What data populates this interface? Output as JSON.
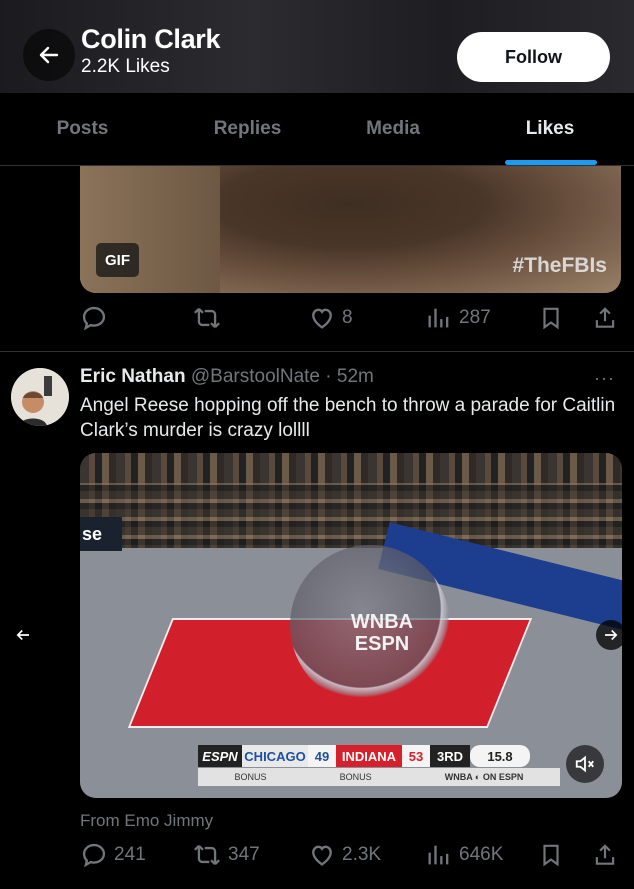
{
  "header": {
    "title": "Colin Clark",
    "subtitle": "2.2K Likes",
    "follow_label": "Follow"
  },
  "tabs": [
    {
      "label": "Posts",
      "active": false
    },
    {
      "label": "Replies",
      "active": false
    },
    {
      "label": "Media",
      "active": false
    },
    {
      "label": "Likes",
      "active": true
    }
  ],
  "tweet1": {
    "media_badge": "GIF",
    "media_caption": "#TheFBIs",
    "likes": "8",
    "views": "287"
  },
  "tweet2": {
    "name": "Eric Nathan",
    "handle": "@BarstoolNate",
    "separator": " · ",
    "time": "52m",
    "more": "···",
    "text": "Angel Reese hopping off the bench to throw a parade for Caitlin Clark’s murder is crazy lollll",
    "video": {
      "overlay_left": "se",
      "logo_line1": "WNBA",
      "logo_line2": "ESPN",
      "score": {
        "network": "ESPN",
        "team1": "CHICAGO",
        "score1": "49",
        "team2": "INDIANA",
        "score2": "53",
        "period": "3RD",
        "clock": "15.8",
        "bonus": "BONUS",
        "league_on": "WNBA ◐ ON ESPN"
      }
    },
    "from": "From Emo Jimmy",
    "replies": "241",
    "reposts": "347",
    "likes": "2.3K",
    "views": "646K"
  },
  "colors": {
    "accent": "#1d9bf0",
    "muted": "#71767b",
    "background": "#000000"
  },
  "icons": [
    "back-arrow-icon",
    "reply-icon",
    "repost-icon",
    "like-icon",
    "views-icon",
    "bookmark-icon",
    "share-icon",
    "more-icon",
    "mute-icon",
    "prev-arrow-icon",
    "next-arrow-icon"
  ]
}
